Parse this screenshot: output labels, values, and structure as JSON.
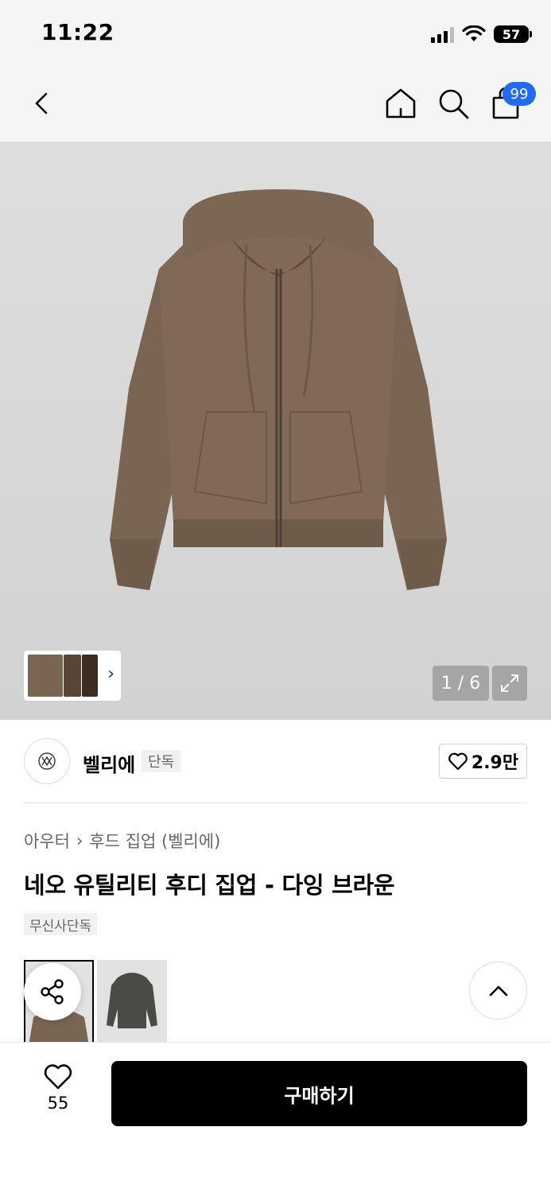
{
  "status_bar": {
    "time": "11:22",
    "battery": "57",
    "icons": [
      "signal-icon",
      "wifi-icon",
      "battery-icon"
    ]
  },
  "nav": {
    "icons": [
      "back-icon",
      "home-icon",
      "search-icon",
      "cart-icon"
    ],
    "cart_badge": "99",
    "badge_color": "#1f6cf0"
  },
  "gallery": {
    "counter": "1 / 6",
    "icons": [
      "chevron-right-icon",
      "expand-icon"
    ]
  },
  "brand": {
    "name": "벨리에",
    "tag": "단독",
    "likes": "2.9만",
    "icons": [
      "brand-logo",
      "heart-icon"
    ]
  },
  "product": {
    "breadcrumb": [
      "아우터",
      "후드 집업 (벨리에)"
    ],
    "title": "네오 유틸리티 후디 집업 - 다잉 브라운",
    "exclusive_label": "무신사단독"
  },
  "color_options": [
    {
      "name": "다잉 브라운",
      "selected": true
    },
    {
      "name": "charcoal",
      "selected": false
    }
  ],
  "actions": {
    "icons": [
      "share-icon",
      "chevron-up-icon"
    ]
  },
  "bottom_bar": {
    "wish_count": "55",
    "buy_label": "구매하기",
    "icons": [
      "heart-icon"
    ]
  }
}
